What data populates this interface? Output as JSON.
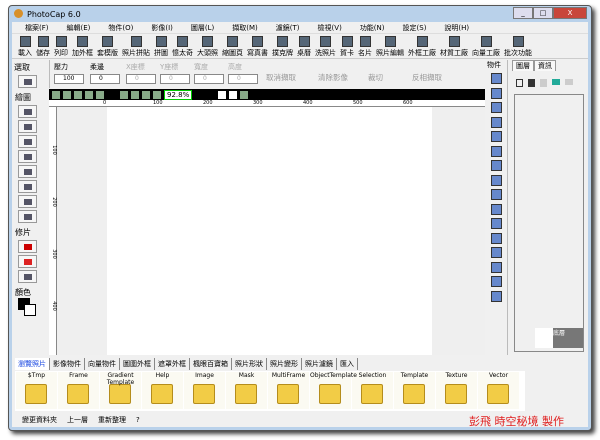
{
  "window": {
    "title": "PhotoCap 6.0",
    "buttons": [
      "_",
      "□",
      "X"
    ]
  },
  "menu": [
    "檔案(F)",
    "編輯(E)",
    "物件(O)",
    "影像(I)",
    "圖層(L)",
    "擷取(M)",
    "濾鏡(T)",
    "檢視(V)",
    "功能(N)",
    "設定(S)",
    "說明(H)"
  ],
  "toolbar": [
    "載入",
    "儲存",
    "列印",
    "加外框",
    "套模版",
    "照片拼貼",
    "拼圖",
    "憶太奇",
    "大頭照",
    "縮圖頁",
    "寫真書",
    "撲克牌",
    "桌曆",
    "洗照片",
    "賀卡",
    "名片",
    "照片編輯",
    "外框工廠",
    "材質工廠",
    "向量工廠",
    "批次功能"
  ],
  "options": {
    "pressure_label": "壓力",
    "pressure": "100",
    "feather_label": "柔邊",
    "feather": "0",
    "x_label": "X座標",
    "x": "0",
    "y_label": "Y座標",
    "y": "0",
    "w_label": "寬度",
    "w": "0",
    "h_label": "高度",
    "h": "0",
    "unit": "PIXL",
    "buttons": [
      "取消擷取",
      "清除影像",
      "裁切",
      "反相擷取"
    ]
  },
  "view": {
    "zoom": "92.8%"
  },
  "ruler": {
    "h": [
      "0",
      "100",
      "200",
      "300",
      "400",
      "500",
      "600"
    ],
    "v": [
      "100",
      "200",
      "300",
      "400"
    ]
  },
  "left_panel": {
    "select": "選取",
    "draw": "繪圖",
    "repair": "修片",
    "color": "顏色"
  },
  "objects": {
    "label": "物件"
  },
  "layers": {
    "tabs": [
      "圖層",
      "資訊"
    ],
    "layer_name": "底層"
  },
  "bottom_tabs": [
    "瀏覽照片",
    "影像物件",
    "向量物件",
    "圖圍外框",
    "遮罩外框",
    "楓眼百寶箱",
    "照片形狀",
    "照片變形",
    "照片濾鏡",
    "匯入"
  ],
  "folders": [
    "$Tmp",
    "Frame",
    "Gradient Template",
    "Help",
    "Image",
    "Mask",
    "MultiFrame",
    "ObjectTemplate",
    "Selection",
    "Template",
    "Texture",
    "Vector"
  ],
  "status": {
    "change_folder": "變更資料夾",
    "up": "上一層",
    "refresh": "重新整理",
    "help": "?"
  },
  "signature": "彭飛 時空秘境 製作",
  "colors": {
    "accent": "#1040e0",
    "signature": "#e02020"
  }
}
